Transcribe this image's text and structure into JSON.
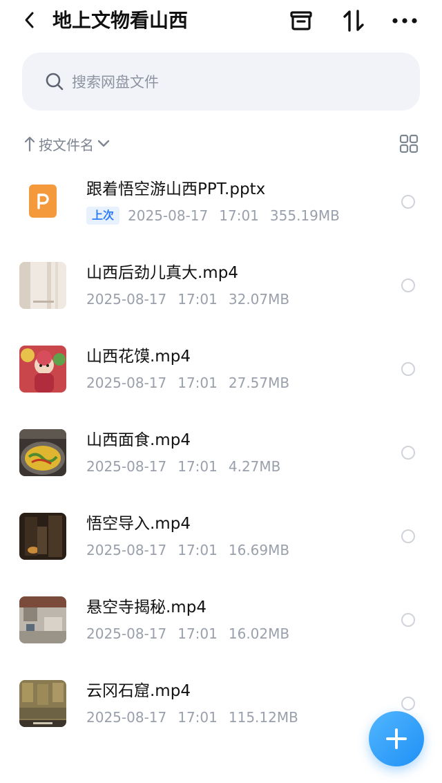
{
  "header": {
    "title": "地上文物看山西",
    "icons": {
      "back": "chevron-left-icon",
      "archive": "archive-box-icon",
      "sort": "sort-arrows-icon",
      "more": "more-dots-icon"
    }
  },
  "search": {
    "placeholder": "搜索网盘文件",
    "icon": "search-icon"
  },
  "sort": {
    "label": "按文件名"
  },
  "colors": {
    "accent": "#2e7cf6",
    "badge_bg": "#e8f2ff",
    "ppt_orange": "#f59a3c",
    "fab": "#1e90f5"
  },
  "files": [
    {
      "name": "跟着悟空游山西PPT.pptx",
      "badge": "上次",
      "date": "2025-08-17",
      "time": "17:01",
      "size": "355.19MB",
      "icon": "ppt-file-icon"
    },
    {
      "name": "山西后劲儿真大.mp4",
      "date": "2025-08-17",
      "time": "17:01",
      "size": "32.07MB",
      "icon": "video-thumbnail"
    },
    {
      "name": "山西花馍.mp4",
      "date": "2025-08-17",
      "time": "17:01",
      "size": "27.57MB",
      "icon": "video-thumbnail"
    },
    {
      "name": "山西面食.mp4",
      "date": "2025-08-17",
      "time": "17:01",
      "size": "4.27MB",
      "icon": "video-thumbnail"
    },
    {
      "name": "悟空导入.mp4",
      "date": "2025-08-17",
      "time": "17:01",
      "size": "16.69MB",
      "icon": "video-thumbnail"
    },
    {
      "name": "悬空寺揭秘.mp4",
      "date": "2025-08-17",
      "time": "17:01",
      "size": "16.02MB",
      "icon": "video-thumbnail"
    },
    {
      "name": "云冈石窟.mp4",
      "date": "2025-08-17",
      "time": "17:01",
      "size": "115.12MB",
      "icon": "video-thumbnail"
    }
  ]
}
